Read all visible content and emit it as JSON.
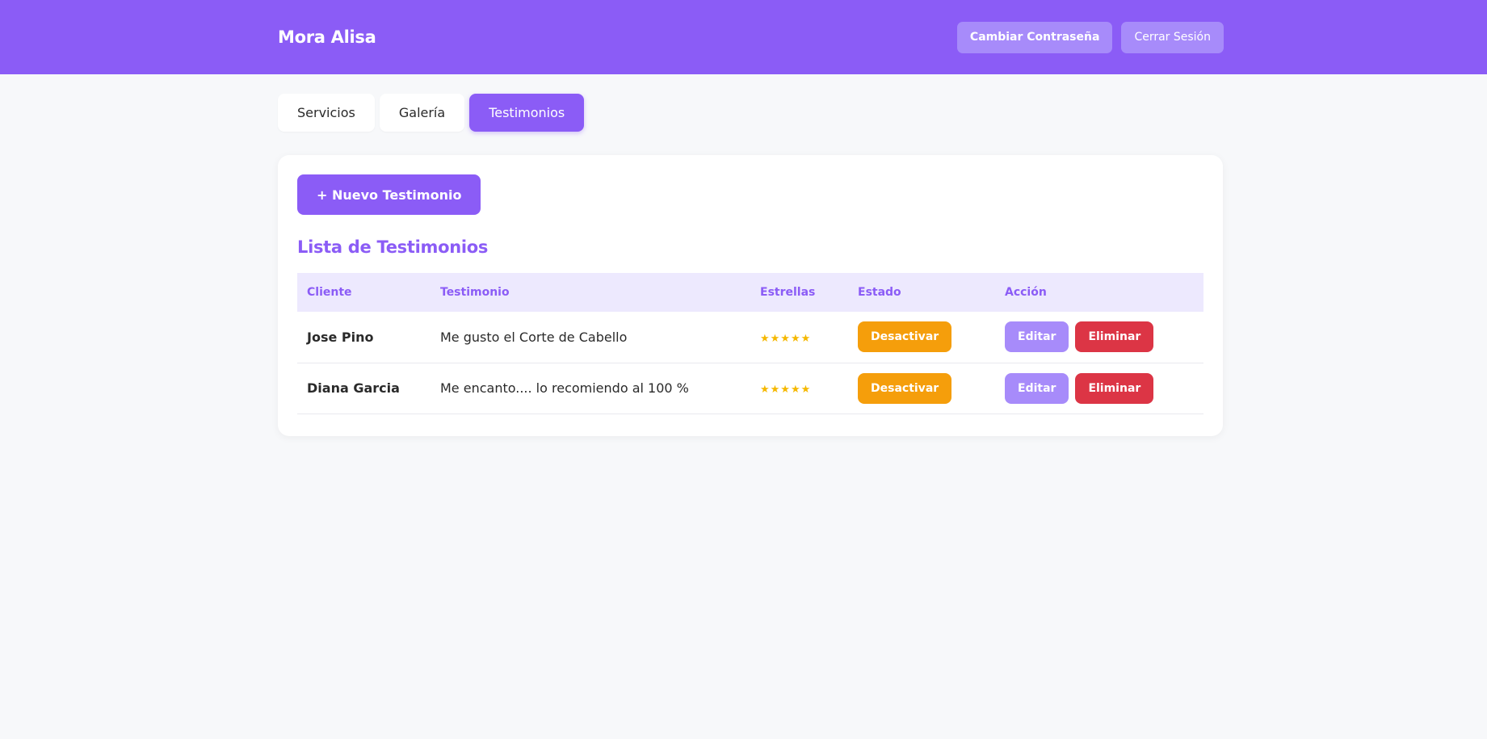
{
  "header": {
    "brand": "Mora Alisa",
    "change_password": "Cambiar Contraseña",
    "logout": "Cerrar Sesión"
  },
  "tabs": [
    {
      "label": "Servicios",
      "active": false
    },
    {
      "label": "Galería",
      "active": false
    },
    {
      "label": "Testimonios",
      "active": true
    }
  ],
  "main": {
    "new_button": "+ Nuevo Testimonio",
    "list_title": "Lista de Testimonios",
    "columns": [
      "Cliente",
      "Testimonio",
      "Estrellas",
      "Estado",
      "Acción"
    ],
    "rows": [
      {
        "client": "Jose Pino",
        "testimonial": "Me gusto el Corte de Cabello",
        "stars": "★★★★★",
        "rating": 5,
        "state_button": "Desactivar",
        "edit_button": "Editar",
        "delete_button": "Eliminar"
      },
      {
        "client": "Diana Garcia",
        "testimonial": "Me encanto.... lo recomiendo al 100 %",
        "stars": "★★★★★",
        "rating": 5,
        "state_button": "Desactivar",
        "edit_button": "Editar",
        "delete_button": "Eliminar"
      }
    ]
  },
  "colors": {
    "primary": "#8b5cf6",
    "primary_light": "#a78bfa",
    "header_row": "#ede9fe",
    "warning": "#f59e0b",
    "danger": "#dc3545",
    "star": "#f5b800"
  }
}
